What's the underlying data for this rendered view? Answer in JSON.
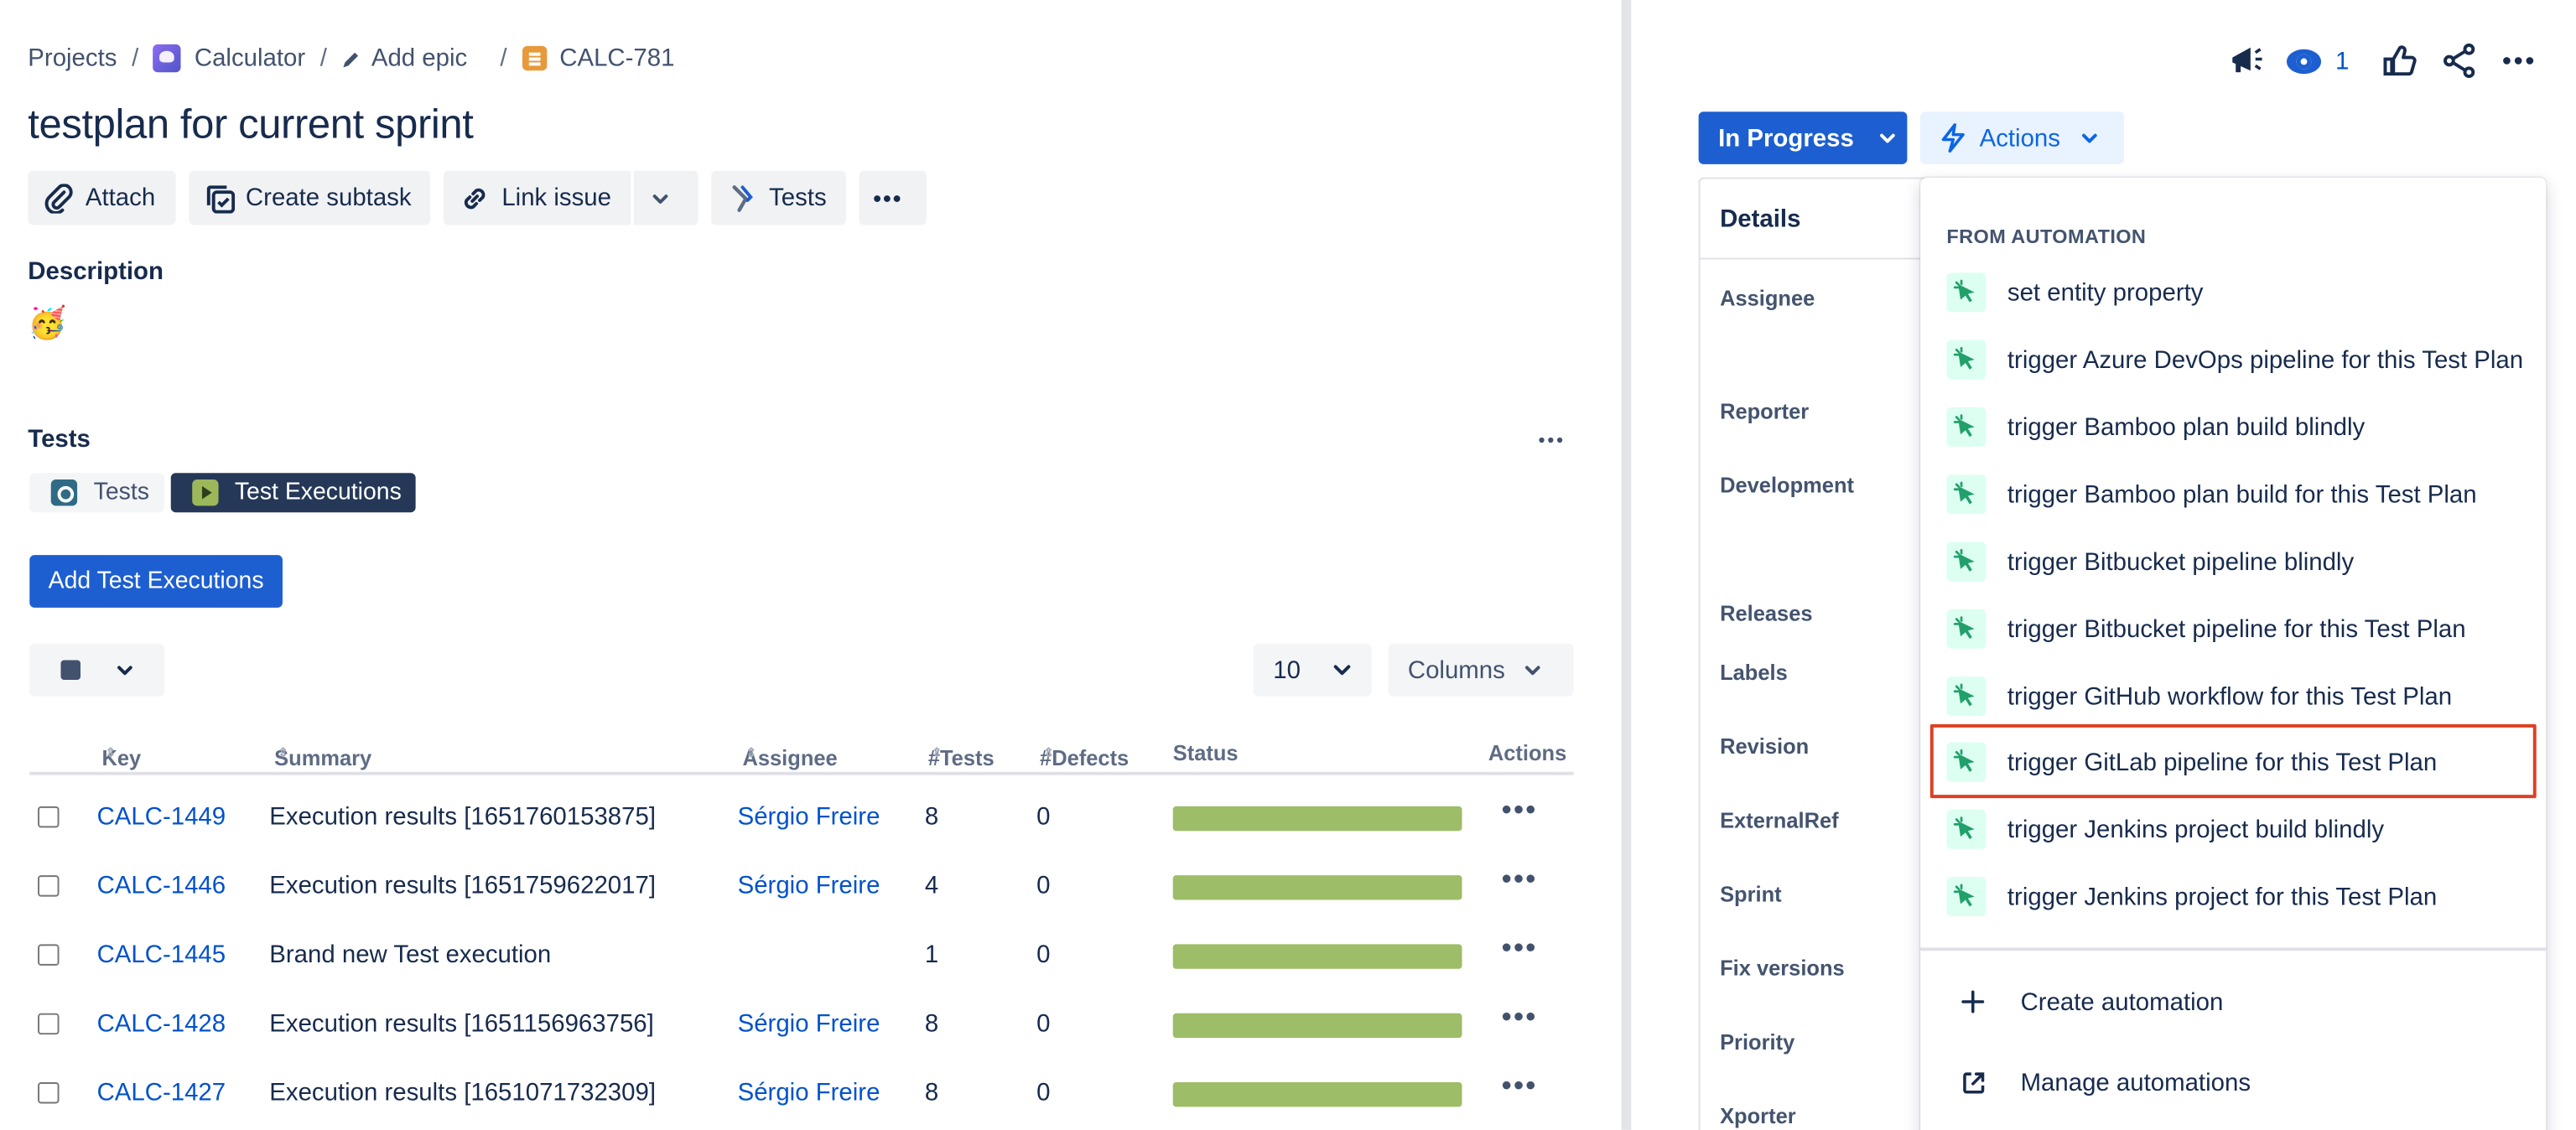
{
  "breadcrumb": {
    "projects": "Projects",
    "project": "Calculator",
    "add_epic": "Add epic",
    "issue_key": "CALC-781",
    "separator": "/"
  },
  "issue": {
    "title": "testplan for current sprint",
    "description_label": "Description",
    "description_emoji": "🥳"
  },
  "toolbar": {
    "attach": "Attach",
    "create_subtask": "Create subtask",
    "link_issue": "Link issue",
    "tests": "Tests"
  },
  "tests_section": {
    "label": "Tests",
    "tabs": [
      "Tests",
      "Test Executions"
    ],
    "active_tab": "Test Executions",
    "add_button": "Add Test Executions",
    "page_size": "10",
    "columns_button": "Columns"
  },
  "table": {
    "headers": {
      "key": "Key",
      "summary": "Summary",
      "assignee": "Assignee",
      "tests": "#Tests",
      "defects": "#Defects",
      "status": "Status",
      "actions": "Actions"
    },
    "rows": [
      {
        "key": "CALC-1449",
        "summary": "Execution results [1651760153875]",
        "assignee": "Sérgio Freire",
        "tests": "8",
        "defects": "0",
        "status_pass_fraction": 1.0
      },
      {
        "key": "CALC-1446",
        "summary": "Execution results [1651759622017]",
        "assignee": "Sérgio Freire",
        "tests": "4",
        "defects": "0",
        "status_pass_fraction": 1.0
      },
      {
        "key": "CALC-1445",
        "summary": "Brand new Test execution",
        "assignee": "",
        "tests": "1",
        "defects": "0",
        "status_pass_fraction": 1.0
      },
      {
        "key": "CALC-1428",
        "summary": "Execution results [1651156963756]",
        "assignee": "Sérgio Freire",
        "tests": "8",
        "defects": "0",
        "status_pass_fraction": 1.0
      },
      {
        "key": "CALC-1427",
        "summary": "Execution results [1651071732309]",
        "assignee": "Sérgio Freire",
        "tests": "8",
        "defects": "0",
        "status_pass_fraction": 1.0
      }
    ]
  },
  "header_actions": {
    "watch_count": "1"
  },
  "status_button": "In Progress",
  "actions_button": "Actions",
  "details": {
    "title": "Details",
    "fields": [
      "Assignee",
      "Reporter",
      "Development",
      "Releases",
      "Labels",
      "Revision",
      "ExternalRef",
      "Sprint",
      "Fix versions",
      "Priority",
      "Xporter"
    ]
  },
  "actions_menu": {
    "section_header": "FROM AUTOMATION",
    "items": [
      "set entity property",
      "trigger Azure DevOps pipeline for this Test Plan",
      "trigger Bamboo plan build blindly",
      "trigger Bamboo plan build for this Test Plan",
      "trigger Bitbucket pipeline blindly",
      "trigger Bitbucket pipeline for this Test Plan",
      "trigger GitHub workflow for this Test Plan",
      "trigger GitLab pipeline for this Test Plan",
      "trigger Jenkins project build blindly",
      "trigger Jenkins project for this Test Plan"
    ],
    "highlighted_item": "trigger GitLab pipeline for this Test Plan",
    "create_automation": "Create automation",
    "manage_automations": "Manage automations"
  },
  "colors": {
    "primary": "#1d5fd1",
    "link": "#0052cc",
    "pass_bar": "#9dbd68",
    "highlight_border": "#de3f24",
    "automation_icon": "#22a06b"
  }
}
